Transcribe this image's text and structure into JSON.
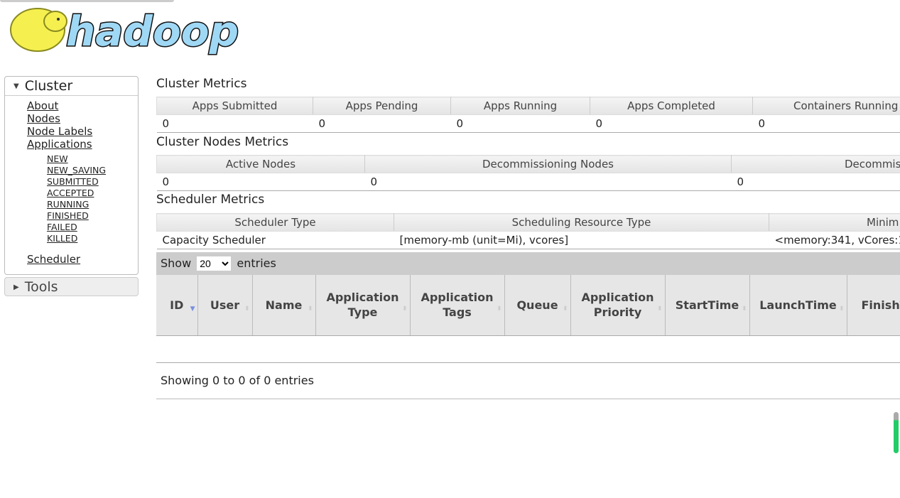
{
  "logo": {
    "text": "hadoop"
  },
  "sidebar": {
    "cluster_label": "Cluster",
    "links": [
      "About",
      "Nodes",
      "Node Labels",
      "Applications"
    ],
    "app_states": [
      "NEW",
      "NEW_SAVING",
      "SUBMITTED",
      "ACCEPTED",
      "RUNNING",
      "FINISHED",
      "FAILED",
      "KILLED"
    ],
    "scheduler": "Scheduler",
    "tools_label": "Tools"
  },
  "cluster_metrics": {
    "title": "Cluster Metrics",
    "headers": [
      "Apps Submitted",
      "Apps Pending",
      "Apps Running",
      "Apps Completed",
      "Containers Running"
    ],
    "values": [
      "0",
      "0",
      "0",
      "0",
      "0"
    ]
  },
  "node_metrics": {
    "title": "Cluster Nodes Metrics",
    "headers": [
      "Active Nodes",
      "Decommissioning Nodes",
      "Decommis"
    ],
    "values": [
      "0",
      "0",
      "0"
    ]
  },
  "scheduler_metrics": {
    "title": "Scheduler Metrics",
    "headers": [
      "Scheduler Type",
      "Scheduling Resource Type",
      "Minim"
    ],
    "values": [
      "Capacity Scheduler",
      "[memory-mb (unit=Mi), vcores]",
      "<memory:341, vCores:1"
    ]
  },
  "apps": {
    "show": "Show",
    "page_size": "20",
    "entries": "entries",
    "columns": [
      "ID",
      "User",
      "Name",
      "Application Type",
      "Application Tags",
      "Queue",
      "Application Priority",
      "StartTime",
      "LaunchTime",
      "FinishT"
    ],
    "info": "Showing 0 to 0 of 0 entries"
  },
  "colors": {
    "logo_blue": "#9fd8f5",
    "logo_yellow": "#f5f050",
    "sort_active": "#7a8fe0",
    "scroll_green": "#22cc66"
  }
}
